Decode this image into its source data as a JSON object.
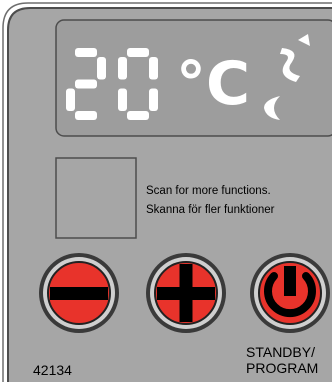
{
  "display": {
    "temperature_digits": "20",
    "unit": "°C",
    "mode_icon": "heating-wave-icon"
  },
  "qr_area": {
    "line1": "Scan for more functions.",
    "line2": "Skanna för fler funktioner"
  },
  "buttons": {
    "minus": {
      "icon": "minus-icon",
      "color": "#e8332b"
    },
    "plus": {
      "icon": "plus-icon",
      "color": "#e8332b"
    },
    "standby": {
      "icon": "power-icon",
      "color": "#e8332b",
      "label_line1": "STANDBY/",
      "label_line2": "PROGRAM"
    }
  },
  "model_number": "42134",
  "colors": {
    "panel_bg": "#a6a6a6",
    "panel_border": "#4d4d4d",
    "segment_on": "#ffffff",
    "button_red": "#e8332b"
  }
}
